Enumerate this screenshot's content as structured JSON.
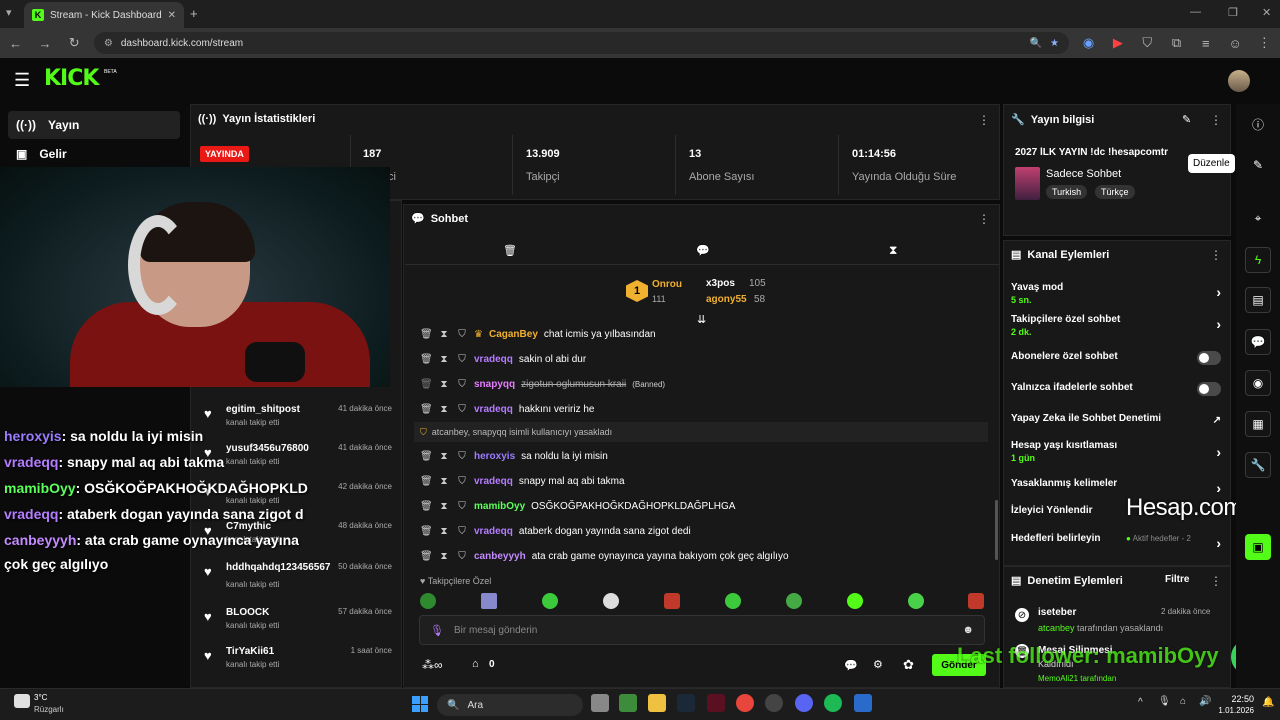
{
  "browser": {
    "tab_title": "Stream - Kick Dashboard",
    "url": "dashboard.kick.com/stream"
  },
  "header": {
    "logo": "KICK",
    "beta": "BETA"
  },
  "nav": {
    "items": [
      {
        "label": "Yayın",
        "icon": "broadcast-icon"
      },
      {
        "label": "Gelir",
        "icon": "revenue-icon"
      }
    ]
  },
  "stats": {
    "title": "Yayın İstatistikleri",
    "live_badge": "YAYINDA",
    "viewers_value": "187",
    "viewers_label_partial": "ci",
    "followers_value": "13.909",
    "followers_label": "Takipçi",
    "subs_value": "13",
    "subs_label": "Abone Sayısı",
    "uptime_value": "01:14:56",
    "uptime_label": "Yayında Olduğu Süre"
  },
  "overlay_chat": [
    {
      "user": "heroxyis",
      "text": ": sa noldu la iyi misin",
      "color": "#9c7cff"
    },
    {
      "user": "vradeqq",
      "text": ": snapy mal aq abi takma",
      "color": "#b57cff"
    },
    {
      "user": "mamibOyy",
      "text": ": OSĞKOĞPAKHOĞKDAĞHOPKLD",
      "color": "#5cff5c"
    },
    {
      "user": "vradeqq",
      "text": ": ataberk dogan yayında sana zigot d",
      "color": "#b57cff"
    },
    {
      "user": "canbeyyyh",
      "text": ": ata crab game oynayınca yayına",
      "color": "#c38bff"
    },
    {
      "user": "",
      "text": "çok geç algılıyo",
      "color": "#ffffff"
    }
  ],
  "followers": [
    {
      "name": "egitim_shitpost",
      "sub": "kanalı takip etti",
      "time": "41 dakika önce"
    },
    {
      "name": "yusuf3456u76800",
      "sub": "kanalı takip etti",
      "time": "41 dakika önce"
    },
    {
      "name": "",
      "sub": "kanalı takip etti",
      "time": "42 dakika önce"
    },
    {
      "name": "C7mythic",
      "sub": "kanalı takip etti",
      "time": "48 dakika önce"
    },
    {
      "name": "hddhqahdq123456567",
      "sub": "kanalı takip etti",
      "time": "50 dakika önce"
    },
    {
      "name": "BLOOCK",
      "sub": "kanalı takip etti",
      "time": "57 dakika önce"
    },
    {
      "name": "TirYaKii61",
      "sub": "kanalı takip etti",
      "time": "1 saat önce"
    }
  ],
  "chat": {
    "title": "Sohbet",
    "leaderboard": [
      {
        "rank": "1",
        "name": "Onrou",
        "score": "111"
      },
      {
        "name": "x3pos",
        "score": "105"
      },
      {
        "name": "agony55",
        "score": "58"
      }
    ],
    "messages": [
      {
        "user": "CaganBey",
        "text": "chat icmis ya yılbasından",
        "color": "#f0b030",
        "badge": "crown"
      },
      {
        "user": "vradeqq",
        "text": "sakin ol abi dur",
        "color": "#b57cff"
      },
      {
        "user": "snapyqq",
        "text": "zigotun oglumusun kraii",
        "color": "#e67cff",
        "banned": "(Banned)"
      },
      {
        "user": "vradeqq",
        "text": "hakkını veririz he",
        "color": "#b57cff"
      },
      {
        "user": "heroxyis",
        "text": "sa noldu la iyi misin",
        "color": "#9c7cff"
      },
      {
        "user": "vradeqq",
        "text": "snapy mal aq abi takma",
        "color": "#b57cff"
      },
      {
        "user": "mamibOyy",
        "text": "OSĞKOĞPAKHOĞKDAĞHOPKLDAĞPLHGA",
        "color": "#5cff5c"
      },
      {
        "user": "vradeqq",
        "text": "ataberk dogan yayında sana zigot dedi",
        "color": "#b57cff"
      },
      {
        "user": "canbeyyyh",
        "text": "ata crab game oynayınca yayına bakıyom çok geç algılıyo",
        "color": "#c38bff"
      }
    ],
    "system_notice": "atcanbey, snapyqq isimli kullanıcıyı yasakladı",
    "followers_only": "Takipçilere Özel",
    "input_placeholder": "Bir mesaj gönderin",
    "send_label": "Gönder",
    "points": "0"
  },
  "stream_info": {
    "title": "Yayın bilgisi",
    "stream_title": "2027 İLK YAYIN !dc !hesapcomtr",
    "category": "Sadece Sohbet",
    "tags": [
      "Turkish",
      "Türkçe"
    ],
    "tooltip": "Düzenle"
  },
  "channel_actions": {
    "title": "Kanal Eylemleri",
    "items": [
      {
        "label": "Yavaş mod",
        "sub": "5 sn.",
        "control": "chevron"
      },
      {
        "label": "Takipçilere özel sohbet",
        "sub": "2 dk.",
        "control": "chevron"
      },
      {
        "label": "Abonelere özel sohbet",
        "sub": "",
        "control": "toggle"
      },
      {
        "label": "Yalnızca ifadelerle sohbet",
        "sub": "",
        "control": "toggle"
      },
      {
        "label": "Yapay Zeka ile Sohbet Denetimi",
        "sub": "",
        "control": "external"
      },
      {
        "label": "Hesap yaşı kısıtlaması",
        "sub": "1 gün",
        "control": "chevron"
      },
      {
        "label": "Yasaklanmış kelimeler",
        "sub": "",
        "control": "chevron"
      },
      {
        "label": "İzleyici Yönlendir",
        "sub": "",
        "control": "none"
      },
      {
        "label": "Hedefleri belirleyin",
        "sub": "",
        "control": "chevron"
      }
    ],
    "goals_status": "Aktif hedefler - 2"
  },
  "watermark": "Hesap.com",
  "moderation": {
    "title": "Denetim Eylemleri",
    "filter": "Filtre",
    "items": [
      {
        "name": "iseteber",
        "by": "atcanbey",
        "by_suffix": "tarafından yasaklandı",
        "time": "2 dakika önce"
      },
      {
        "name": "Mesaj Silinmesi",
        "by": "Kaldırıldı",
        "by_suffix": "",
        "time": ""
      }
    ],
    "partial_footer": "MemoAli21 tarafından"
  },
  "last_follower_overlay": "Last follower: mamibOyy",
  "taskbar": {
    "weather_temp": "3°C",
    "weather_desc": "Rüzgarlı",
    "search": "Ara",
    "time": "22:50",
    "date": "1.01.2026"
  },
  "colors": {
    "brand": "#53fc18",
    "live": "#e91916",
    "panel": "#181818"
  }
}
